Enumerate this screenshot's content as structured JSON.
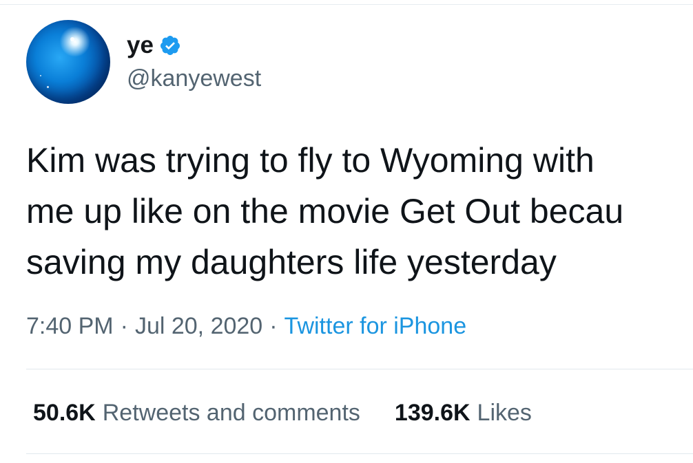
{
  "author": {
    "display_name": "ye",
    "handle": "@kanyewest",
    "verified": true
  },
  "tweet": {
    "lines": [
      "Kim was trying to fly to Wyoming with",
      "me up like on the movie Get Out becau",
      "saving my daughters life yesterday"
    ]
  },
  "meta": {
    "time": "7:40 PM",
    "separator": "·",
    "date": "Jul 20, 2020",
    "source": "Twitter for iPhone"
  },
  "stats": {
    "retweets_count": "50.6K",
    "retweets_label": "Retweets and comments",
    "likes_count": "139.6K",
    "likes_label": "Likes"
  },
  "colors": {
    "verified": "#1d9bf0",
    "link": "#1b95e0",
    "secondary_text": "#536471"
  },
  "icons": {
    "verified": "verified-badge-icon"
  }
}
